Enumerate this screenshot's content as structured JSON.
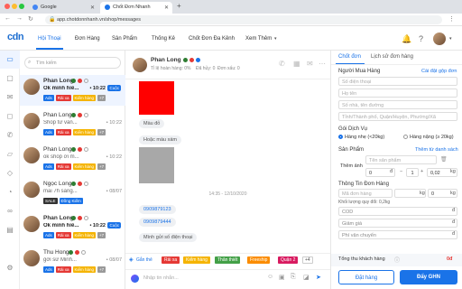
{
  "browser": {
    "tabs": [
      {
        "label": "Google"
      },
      {
        "label": "Chốt Đơn Nhanh"
      }
    ],
    "url": "app.chotdonnhanh.vn/shop/messages",
    "add_tab": "+"
  },
  "app": {
    "logo": "cdn",
    "nav": [
      {
        "label": "Hội Thoại"
      },
      {
        "label": "Đơn Hàng"
      },
      {
        "label": "Sản Phẩm"
      },
      {
        "label": "Thống Kê"
      },
      {
        "label": "Chốt Đơn Đa Kênh"
      },
      {
        "label": "Xem Thêm"
      }
    ]
  },
  "conversations": {
    "search_placeholder": "Tìm kiếm",
    "items": [
      {
        "name": "Phan Long",
        "message": "Ok mình hiể...",
        "time": "• 10:22",
        "tags": [
          "Ads",
          "Rải xa",
          "Kiểm hàng",
          "+7"
        ],
        "badge": "Cuộc",
        "bold": true
      },
      {
        "name": "Phan Long",
        "message": "Shop tư vấn...",
        "time": "• 10:22",
        "tags": [
          "Ads",
          "Rải xa",
          "Kiểm hàng",
          "+7"
        ],
        "bold": false
      },
      {
        "name": "Phan Long",
        "message": "ok shop ơi m...",
        "time": "• 10:22",
        "tags": [
          "Ads",
          "Rải xa",
          "Kiểm hàng",
          "+7"
        ],
        "bold": false
      },
      {
        "name": "Ngọc Long",
        "message": "mai 7h sáng...",
        "time": "• 08/07",
        "tags": [
          "SALE",
          "Đồng Kiểm"
        ],
        "bold": false
      },
      {
        "name": "Phan Long",
        "message": "Ok mình hiể...",
        "time": "• 10:22",
        "tags": [
          "Ads",
          "Rải xa",
          "Kiểm hàng",
          "+7"
        ],
        "badge": "Cuộc",
        "bold": true
      },
      {
        "name": "Thu Hong",
        "message": "gởi sứ Minh...",
        "time": "• 08/07",
        "tags": [
          "Ads",
          "Rải xa",
          "Kiểm hàng",
          "+7"
        ],
        "bold": false
      }
    ]
  },
  "chat": {
    "name": "Phan Long",
    "subtitle": "Tỉ lệ hoàn hàng: 0%",
    "stat2": "Đã hủy: 0",
    "stat3": "Đơn xấu: 0",
    "messages": [
      {
        "text": "Màu đỏ"
      },
      {
        "text": "Hoặc màu xám"
      },
      {
        "text": "0909879123"
      },
      {
        "text": "0909879444"
      },
      {
        "text": "Mình gửi số điện thoại"
      }
    ],
    "timestamp": "14:35 - 12/10/2020",
    "quick_tags": [
      {
        "label": "Gắn thẻ"
      },
      {
        "label": "Rải xa",
        "color": "#e53935"
      },
      {
        "label": "Kiểm hàng",
        "color": "#f5b400"
      },
      {
        "label": "Thân thiết",
        "color": "#43a047"
      },
      {
        "label": "Freeship",
        "color": "#fb8c00"
      },
      {
        "label": "Quận 2",
        "color": "#d81b60"
      },
      {
        "label": "+4"
      }
    ],
    "input_placeholder": "Nhập tin nhắn..."
  },
  "order": {
    "tabs": [
      {
        "label": "Chốt đơn"
      },
      {
        "label": "Lịch sử đơn hàng"
      }
    ],
    "buyer_title": "Người Mua Hàng",
    "clear_link": "Cài đặt gộp đơn",
    "fields": {
      "phone": "Số điện thoại",
      "name": "Họ tên",
      "address": "Số nhà, tên đường",
      "region": "Tỉnh/Thành phố, Quận/Huyện, Phường/Xã"
    },
    "service_title": "Gói Dịch Vụ",
    "services": [
      {
        "label": "Hàng nhẹ (<20kg)",
        "checked": true
      },
      {
        "label": "Hàng nặng (≥ 20kg)",
        "checked": false
      }
    ],
    "product_title": "Sản Phẩm",
    "product_link": "Thêm từ danh sách",
    "add_label": "Thêm ảnh",
    "product_placeholder": "Tên sản phẩm",
    "price": "0",
    "price_unit": "đ",
    "qty": "1",
    "weight": "0,02",
    "weight_unit": "kg",
    "info_title": "Thông Tin Đơn Hàng",
    "order_weight_placeholder": "Mã đơn hàng",
    "order_weight_unit": "kg",
    "order_w2": "0",
    "order_w2_unit": "kg",
    "note_line": "Khối lượng quy đổi: 0,2kg",
    "cod_label": "COD",
    "cod_unit": "đ",
    "discount_label": "Giảm giá",
    "discount_unit": "đ",
    "extra_label": "Phí vận chuyển",
    "extra_unit": "đ",
    "total_label": "Tổng thu khách hàng",
    "total_value": "0đ",
    "btn_save": "Đặt hàng",
    "btn_ghn": "Đẩy GHN"
  },
  "colors": {
    "accent": "#1a73e8",
    "tag_red": "#e53935",
    "tag_yellow": "#f5b400",
    "zalo": "#1a73e8",
    "messenger": "#2e7d32"
  }
}
